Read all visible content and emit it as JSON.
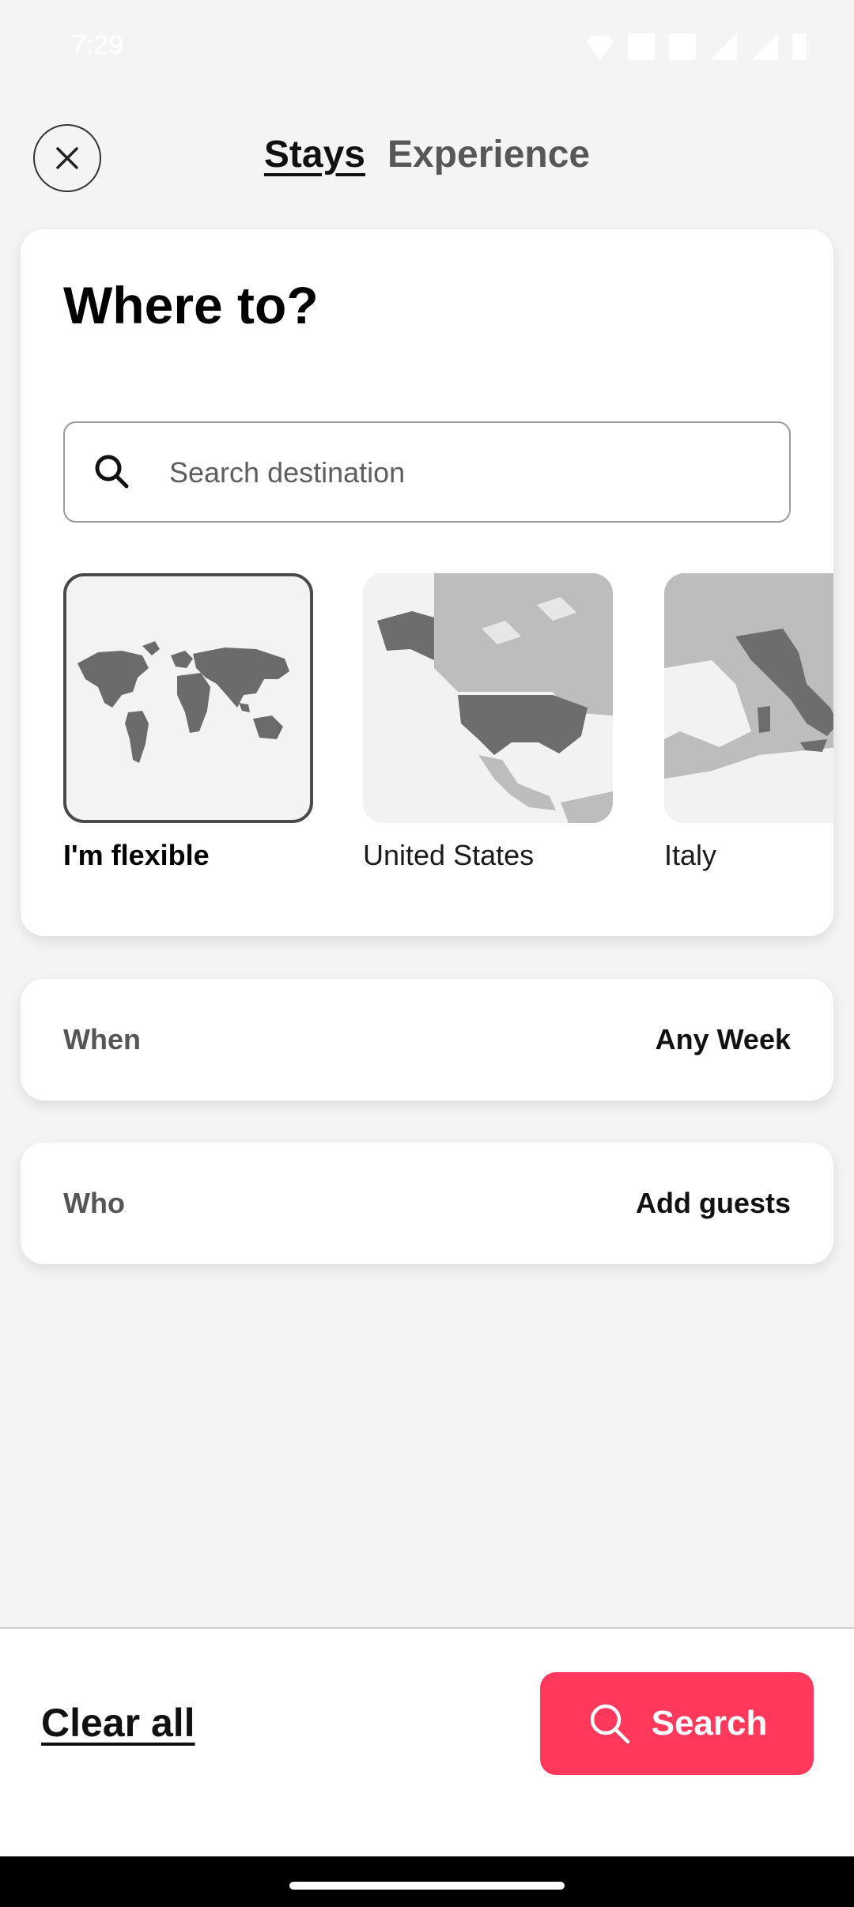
{
  "status": {
    "time": "7:29",
    "icons": [
      "wifi-icon",
      "hd-icon",
      "hd-icon",
      "signal-icon",
      "signal-icon",
      "battery-icon"
    ]
  },
  "header": {
    "tabs": [
      {
        "label": "Stays",
        "active": true
      },
      {
        "label": "Experience",
        "active": false
      }
    ]
  },
  "where": {
    "title": "Where to?",
    "search_placeholder": "Search destination",
    "destinations": [
      {
        "label": "I'm flexible",
        "selected": true,
        "image": "world-map"
      },
      {
        "label": "United States",
        "selected": false,
        "image": "north-america-map"
      },
      {
        "label": "Italy",
        "selected": false,
        "image": "italy-map"
      }
    ]
  },
  "when": {
    "label": "When",
    "value": "Any Week"
  },
  "who": {
    "label": "Who",
    "value": "Add guests"
  },
  "footer": {
    "clear_label": "Clear all",
    "search_label": "Search"
  },
  "colors": {
    "accent": "#ff385c",
    "background": "#f4f4f4",
    "card": "#ffffff"
  }
}
